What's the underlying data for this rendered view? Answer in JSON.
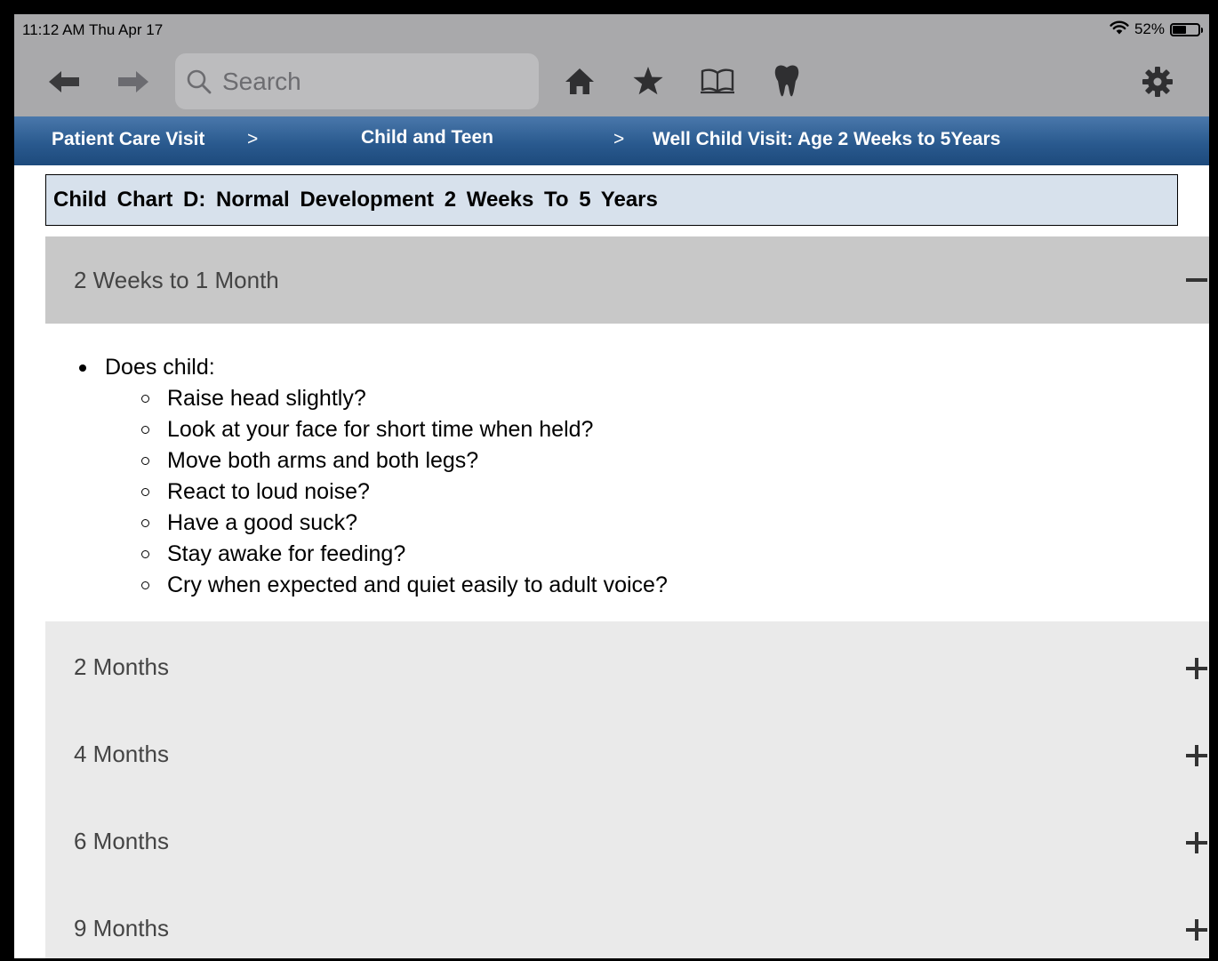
{
  "status_bar": {
    "time_date": "11:12 AM   Thu Apr 17",
    "battery": "52%",
    "battery_level": 0.52
  },
  "toolbar": {
    "back_icon": "arrow-left-icon",
    "forward_icon": "arrow-right-icon",
    "search_placeholder": "Search",
    "home_icon": "home-icon",
    "favorites_icon": "star-icon",
    "library_icon": "open-book-icon",
    "dental_icon": "tooth-icon",
    "settings_icon": "gear-icon"
  },
  "breadcrumb": {
    "items": [
      "Patient Care Visit",
      "Child and Teen",
      "Well Child Visit: Age 2 Weeks to 5Years"
    ],
    "separator": ">"
  },
  "chart_title": "Child  Chart  D:  Normal  Development  2  Weeks  To  5  Years",
  "accordion": {
    "open_section": {
      "label": "2 Weeks to 1 Month",
      "toggle": "−",
      "intro": "Does child:",
      "items": [
        "Raise head slightly?",
        "Look at your face for short time when held?",
        "Move both arms and both legs?",
        "React to loud noise?",
        "Have a good suck?",
        "Stay awake for feeding?",
        "Cry when expected and quiet easily to adult voice?"
      ]
    },
    "collapsed_sections": [
      "2 Months",
      "4 Months",
      "6 Months",
      "9 Months"
    ]
  },
  "colors": {
    "toolbar_bg": "#a9a9ab",
    "breadcrumb_bg": "#2a5a8f",
    "title_bg": "#d7e1ec",
    "open_header_bg": "#c8c8c8",
    "collapsed_header_bg": "#eaeaea"
  }
}
